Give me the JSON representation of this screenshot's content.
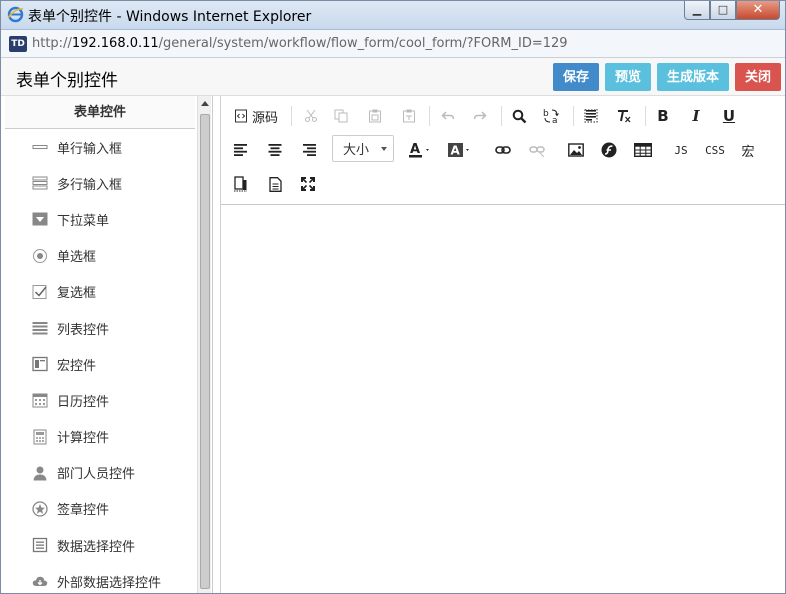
{
  "window": {
    "title": "表单个别控件 - Windows Internet Explorer",
    "minimize_glyph": "▁",
    "maximize_glyph": "□",
    "close_glyph": "✕",
    "td_icon_label": "TD"
  },
  "address": {
    "url_prefix": "http://",
    "url_host": "192.168.0.11",
    "url_path": "/general/system/workflow/flow_form/cool_form/?FORM_ID=129"
  },
  "header": {
    "title": "表单个别控件",
    "buttons": {
      "save": "保存",
      "preview": "预览",
      "generate": "生成版本",
      "close": "关闭"
    }
  },
  "sidebar": {
    "title": "表单控件",
    "items": [
      {
        "label": "单行输入框",
        "icon": "single-line-input-icon"
      },
      {
        "label": "多行输入框",
        "icon": "multi-line-input-icon"
      },
      {
        "label": "下拉菜单",
        "icon": "dropdown-icon"
      },
      {
        "label": "单选框",
        "icon": "radio-icon"
      },
      {
        "label": "复选框",
        "icon": "checkbox-icon"
      },
      {
        "label": "列表控件",
        "icon": "list-icon"
      },
      {
        "label": "宏控件",
        "icon": "macro-icon"
      },
      {
        "label": "日历控件",
        "icon": "calendar-icon"
      },
      {
        "label": "计算控件",
        "icon": "calculator-icon"
      },
      {
        "label": "部门人员控件",
        "icon": "user-icon"
      },
      {
        "label": "签章控件",
        "icon": "seal-icon"
      },
      {
        "label": "数据选择控件",
        "icon": "data-select-icon"
      },
      {
        "label": "外部数据选择控件",
        "icon": "cloud-icon"
      }
    ]
  },
  "editor": {
    "source_label": "源码",
    "font_size_label": "大小",
    "js_label": "JS",
    "css_label": "CSS",
    "macro_label": "宏",
    "bold_glyph": "B",
    "italic_glyph": "I",
    "underline_glyph": "U"
  }
}
